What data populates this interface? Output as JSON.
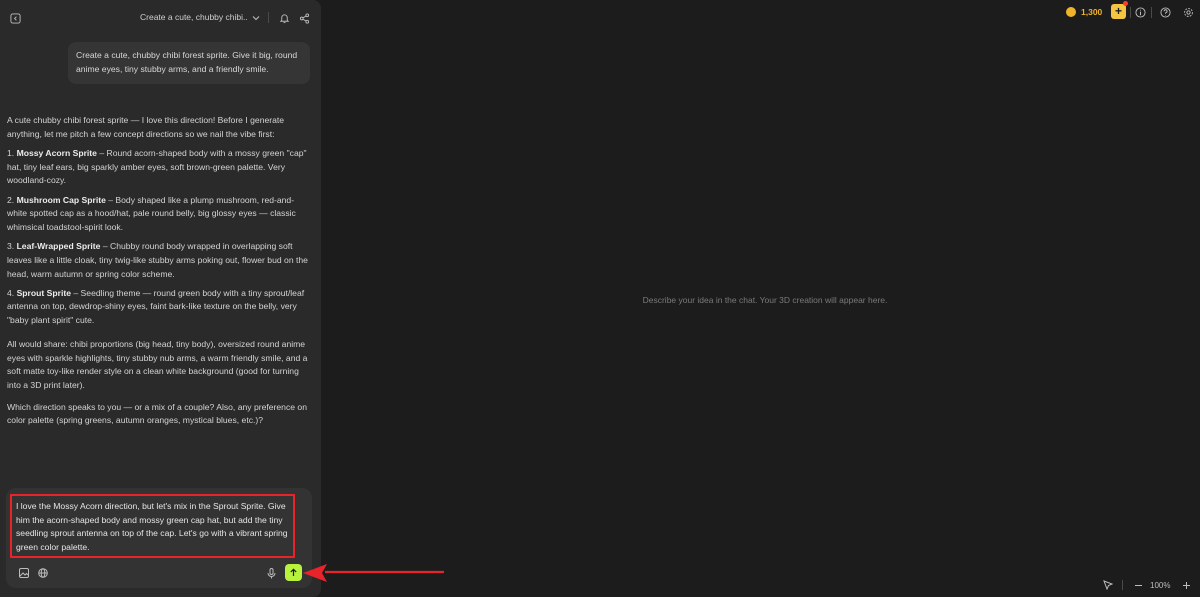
{
  "header": {
    "conversation_title": "Create a cute, chubby chibi..."
  },
  "chat": {
    "user_message": "Create a cute, chubby chibi forest sprite. Give it big, round anime eyes, tiny stubby arms, and a friendly smile.",
    "assistant": {
      "intro": "A cute chubby chibi forest sprite — I love this direction! Before I generate anything, let me pitch a few concept directions so we nail the vibe first:",
      "options": [
        {
          "num": "1.",
          "title": "Mossy Acorn Sprite",
          "text": " – Round acorn-shaped body with a mossy green \"cap\" hat, tiny leaf ears, big sparkly amber eyes, soft brown-green palette. Very woodland-cozy."
        },
        {
          "num": "2.",
          "title": "Mushroom Cap Sprite",
          "text": " – Body shaped like a plump mushroom, red-and-white spotted cap as a hood/hat, pale round belly, big glossy eyes — classic whimsical toadstool-spirit look."
        },
        {
          "num": "3.",
          "title": "Leaf-Wrapped Sprite",
          "text": " – Chubby round body wrapped in overlapping soft leaves like a little cloak, tiny twig-like stubby arms poking out, flower bud on the head, warm autumn or spring color scheme."
        },
        {
          "num": "4.",
          "title": "Sprout Sprite",
          "text": " – Seedling theme — round green body with a tiny sprout/leaf antenna on top, dewdrop-shiny eyes, faint bark-like texture on the belly, very \"baby plant spirit\" cute."
        }
      ],
      "shared": "All would share: chibi proportions (big head, tiny body), oversized round anime eyes with sparkle highlights, tiny stubby nub arms, a warm friendly smile, and a soft matte toy-like render style on a clean white background (good for turning into a 3D print later).",
      "question": "Which direction speaks to you — or a mix of a couple? Also, any preference on color palette (spring greens, autumn oranges, mystical blues, etc.)?"
    }
  },
  "composer": {
    "draft_text": "I love the Mossy Acorn direction, but let's mix in the Sprout Sprite. Give him the acorn-shaped body and mossy green cap hat, but add the tiny seedling sprout antenna on top of the cap. Let's go with a vibrant spring green color palette."
  },
  "canvas": {
    "placeholder": "Describe your idea in the chat. Your 3D creation will appear here.",
    "credits": "1,300",
    "zoom_level": "100%"
  },
  "colors": {
    "send_button": "#b7f23d",
    "credits_accent": "#f0b429",
    "annotation_red": "#e8242a"
  },
  "icons": [
    "sidebar-toggle-icon",
    "chevron-down-icon",
    "bell-icon",
    "share-icon",
    "image-icon",
    "globe-icon",
    "microphone-icon",
    "arrow-up-icon",
    "coin-icon",
    "info-icon",
    "help-icon",
    "settings-icon",
    "pointer-icon",
    "minus-icon",
    "plus-icon"
  ]
}
